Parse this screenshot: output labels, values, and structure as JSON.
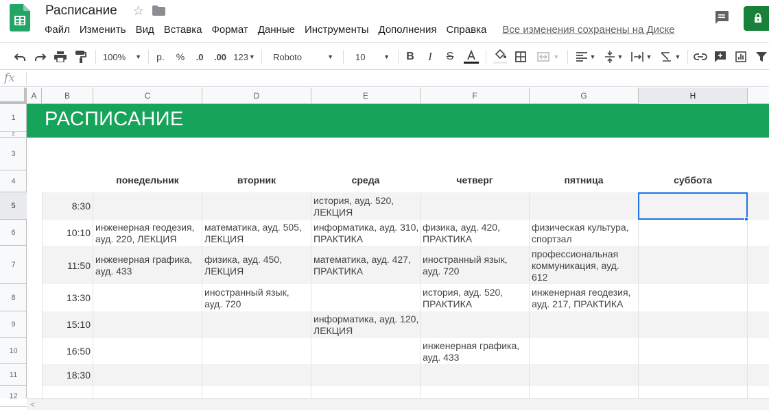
{
  "app": {
    "doc_title": "Расписание",
    "menu": [
      "Файл",
      "Изменить",
      "Вид",
      "Вставка",
      "Формат",
      "Данные",
      "Инструменты",
      "Дополнения",
      "Справка"
    ],
    "saved_status": "Все изменения сохранены на Диске"
  },
  "toolbar": {
    "zoom": "100%",
    "currency": "р.",
    "percent": "%",
    "decimal_decrease": ".0",
    "decimal_increase": ".00",
    "number_format": "123",
    "font": "Roboto",
    "font_size": "10"
  },
  "formula_bar": {
    "fx_label": "fx"
  },
  "columns": [
    "A",
    "B",
    "C",
    "D",
    "E",
    "F",
    "G",
    "H"
  ],
  "rows": [
    "1",
    "2",
    "3",
    "4",
    "5",
    "6",
    "7",
    "8",
    "9",
    "10",
    "11",
    "12"
  ],
  "sheet": {
    "title": "РАСПИСАНИЕ",
    "days": [
      "понедельник",
      "вторник",
      "среда",
      "четверг",
      "пятница",
      "суббота"
    ],
    "schedule": [
      {
        "time": "8:30",
        "cells": [
          "",
          "",
          "история, ауд. 520,\nЛЕКЦИЯ",
          "",
          "",
          ""
        ]
      },
      {
        "time": "10:10",
        "cells": [
          "инженерная геодезия,\nауд. 220, ЛЕКЦИЯ",
          "математика, ауд. 505,\nЛЕКЦИЯ",
          "информатика, ауд. 310,\nПРАКТИКА",
          "физика, ауд. 420,\nПРАКТИКА",
          "физическая культура,\nспортзал",
          ""
        ]
      },
      {
        "time": "11:50",
        "cells": [
          "инженерная графика,\nауд. 433",
          "физика, ауд. 450,\nЛЕКЦИЯ",
          "математика, ауд. 427,\nПРАКТИКА",
          "иностранный язык,\nауд. 720",
          "профессиональная\nкоммуникация, ауд.\n612",
          ""
        ]
      },
      {
        "time": "13:30",
        "cells": [
          "",
          "иностранный язык,\nауд. 720",
          "",
          "история, ауд. 520,\nПРАКТИКА",
          "инженерная геодезия,\nауд. 217, ПРАКТИКА",
          ""
        ]
      },
      {
        "time": "15:10",
        "cells": [
          "",
          "",
          "информатика, ауд. 120,\nЛЕКЦИЯ",
          "",
          "",
          ""
        ]
      },
      {
        "time": "16:50",
        "cells": [
          "",
          "",
          "",
          "инженерная графика,\nауд. 433",
          "",
          ""
        ]
      },
      {
        "time": "18:30",
        "cells": [
          "",
          "",
          "",
          "",
          "",
          ""
        ]
      }
    ]
  },
  "colors": {
    "banner": "#16a35a",
    "selection": "#1a73e8",
    "share": "#188038"
  }
}
